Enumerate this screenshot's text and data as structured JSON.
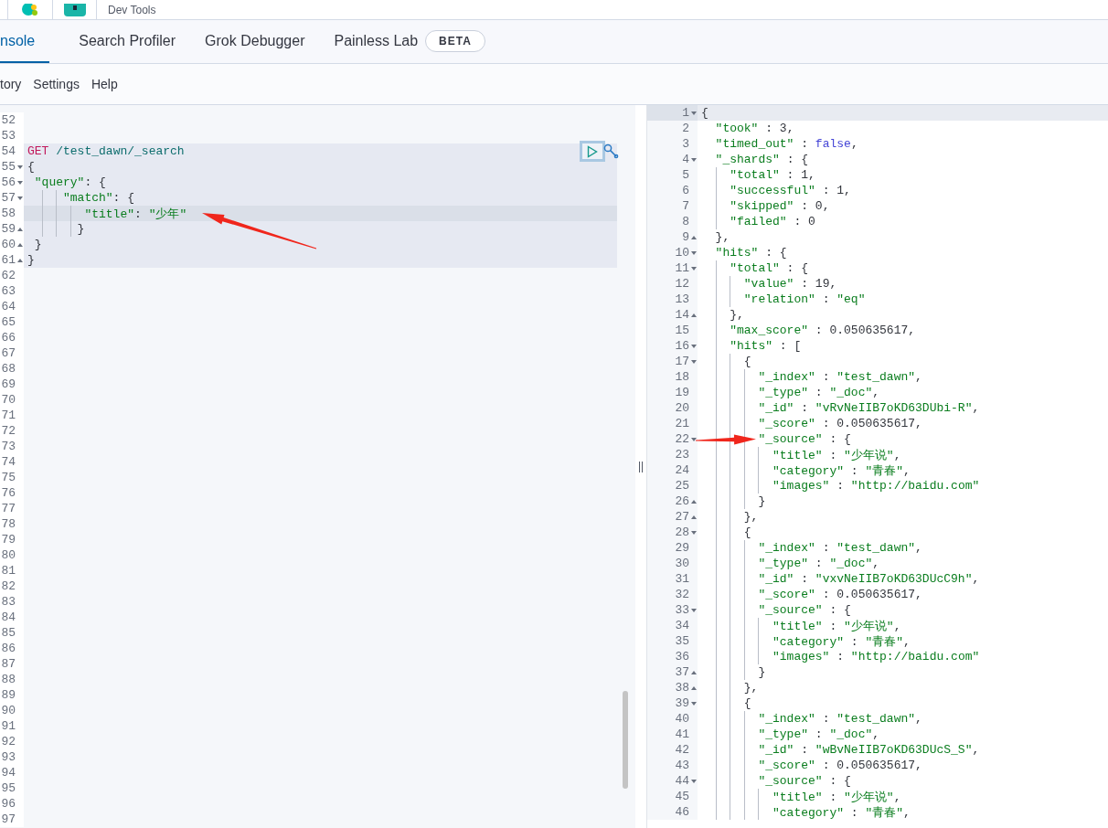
{
  "header": {
    "title": "Dev Tools"
  },
  "tabs": [
    {
      "label": "nsole",
      "selected": true
    },
    {
      "label": "Search Profiler",
      "selected": false
    },
    {
      "label": "Grok Debugger",
      "selected": false
    },
    {
      "label": "Painless Lab",
      "selected": false,
      "badge": "BETA"
    }
  ],
  "menu": [
    "tory",
    "Settings",
    "Help"
  ],
  "request_editor": {
    "lines": [
      {
        "n": "52",
        "in_request": false,
        "active": false
      },
      {
        "n": "53",
        "in_request": false,
        "active": false
      },
      {
        "n": "54",
        "text": "GET /test_dawn/_search",
        "in_request": true,
        "active": false
      },
      {
        "n": "55",
        "text": "{",
        "fold_start": true,
        "in_request": true,
        "active": false
      },
      {
        "n": "56",
        "text": " \"query\": {",
        "fold_start": true,
        "in_request": true,
        "active": false
      },
      {
        "n": "57",
        "text": "     \"match\": {",
        "fold_start": true,
        "in_request": true,
        "active": false
      },
      {
        "n": "58",
        "text": "        \"title\": \"少年\"",
        "in_request": true,
        "active": true
      },
      {
        "n": "59",
        "text": "       }",
        "fold_start": false,
        "in_request": true,
        "active": false
      },
      {
        "n": "60",
        "text": " }",
        "fold_start": false,
        "in_request": true,
        "active": false
      },
      {
        "n": "61",
        "text": "}",
        "fold_start": false,
        "in_request": true,
        "active": false
      },
      {
        "n": "62",
        "in_request": false,
        "active": false
      },
      {
        "n": "63",
        "in_request": false,
        "active": false
      },
      {
        "n": "64",
        "in_request": false,
        "active": false
      },
      {
        "n": "65",
        "in_request": false,
        "active": false
      },
      {
        "n": "66",
        "in_request": false,
        "active": false
      },
      {
        "n": "67",
        "in_request": false,
        "active": false
      },
      {
        "n": "68",
        "in_request": false,
        "active": false
      },
      {
        "n": "69",
        "in_request": false,
        "active": false
      },
      {
        "n": "70",
        "in_request": false,
        "active": false
      },
      {
        "n": "71",
        "in_request": false,
        "active": false
      },
      {
        "n": "72",
        "in_request": false,
        "active": false
      },
      {
        "n": "73",
        "in_request": false,
        "active": false
      },
      {
        "n": "74",
        "in_request": false,
        "active": false
      },
      {
        "n": "75",
        "in_request": false,
        "active": false
      },
      {
        "n": "76",
        "in_request": false,
        "active": false
      },
      {
        "n": "77",
        "in_request": false,
        "active": false
      },
      {
        "n": "78",
        "in_request": false,
        "active": false
      },
      {
        "n": "79",
        "in_request": false,
        "active": false
      },
      {
        "n": "80",
        "in_request": false,
        "active": false
      },
      {
        "n": "81",
        "in_request": false,
        "active": false
      },
      {
        "n": "82",
        "in_request": false,
        "active": false
      },
      {
        "n": "83",
        "in_request": false,
        "active": false
      },
      {
        "n": "84",
        "in_request": false,
        "active": false
      },
      {
        "n": "85",
        "in_request": false,
        "active": false
      },
      {
        "n": "86",
        "in_request": false,
        "active": false
      },
      {
        "n": "87",
        "in_request": false,
        "active": false
      },
      {
        "n": "88",
        "in_request": false,
        "active": false
      },
      {
        "n": "89",
        "in_request": false,
        "active": false
      },
      {
        "n": "90",
        "in_request": false,
        "active": false
      },
      {
        "n": "91",
        "in_request": false,
        "active": false
      },
      {
        "n": "92",
        "in_request": false,
        "active": false
      },
      {
        "n": "93",
        "in_request": false,
        "active": false
      },
      {
        "n": "94",
        "in_request": false,
        "active": false
      },
      {
        "n": "95",
        "in_request": false,
        "active": false
      },
      {
        "n": "96",
        "in_request": false,
        "active": false
      },
      {
        "n": "97",
        "in_request": false,
        "active": false
      }
    ]
  },
  "response_editor": {
    "lines": [
      {
        "n": "1",
        "text": "{",
        "fold_start": true,
        "active": true
      },
      {
        "n": "2",
        "text": "  \"took\" : 3,",
        "active": false
      },
      {
        "n": "3",
        "text": "  \"timed_out\" : false,",
        "active": false
      },
      {
        "n": "4",
        "text": "  \"_shards\" : {",
        "fold_start": true,
        "active": false
      },
      {
        "n": "5",
        "text": "    \"total\" : 1,",
        "active": false
      },
      {
        "n": "6",
        "text": "    \"successful\" : 1,",
        "active": false
      },
      {
        "n": "7",
        "text": "    \"skipped\" : 0,",
        "active": false
      },
      {
        "n": "8",
        "text": "    \"failed\" : 0",
        "active": false
      },
      {
        "n": "9",
        "text": "  },",
        "fold_start": false,
        "active": false
      },
      {
        "n": "10",
        "text": "  \"hits\" : {",
        "fold_start": true,
        "active": false
      },
      {
        "n": "11",
        "text": "    \"total\" : {",
        "fold_start": true,
        "active": false
      },
      {
        "n": "12",
        "text": "      \"value\" : 19,",
        "active": false
      },
      {
        "n": "13",
        "text": "      \"relation\" : \"eq\"",
        "active": false
      },
      {
        "n": "14",
        "text": "    },",
        "fold_start": false,
        "active": false
      },
      {
        "n": "15",
        "text": "    \"max_score\" : 0.050635617,",
        "active": false
      },
      {
        "n": "16",
        "text": "    \"hits\" : [",
        "fold_start": true,
        "active": false
      },
      {
        "n": "17",
        "text": "      {",
        "fold_start": true,
        "active": false
      },
      {
        "n": "18",
        "text": "        \"_index\" : \"test_dawn\",",
        "active": false
      },
      {
        "n": "19",
        "text": "        \"_type\" : \"_doc\",",
        "active": false
      },
      {
        "n": "20",
        "text": "        \"_id\" : \"vRvNeIIB7oKD63DUbi-R\",",
        "active": false
      },
      {
        "n": "21",
        "text": "        \"_score\" : 0.050635617,",
        "active": false
      },
      {
        "n": "22",
        "text": "        \"_source\" : {",
        "fold_start": true,
        "active": false
      },
      {
        "n": "23",
        "text": "          \"title\" : \"少年说\",",
        "active": false
      },
      {
        "n": "24",
        "text": "          \"category\" : \"青春\",",
        "active": false
      },
      {
        "n": "25",
        "text": "          \"images\" : \"http://baidu.com\"",
        "active": false
      },
      {
        "n": "26",
        "text": "        }",
        "fold_start": false,
        "active": false
      },
      {
        "n": "27",
        "text": "      },",
        "fold_start": false,
        "active": false
      },
      {
        "n": "28",
        "text": "      {",
        "fold_start": true,
        "active": false
      },
      {
        "n": "29",
        "text": "        \"_index\" : \"test_dawn\",",
        "active": false
      },
      {
        "n": "30",
        "text": "        \"_type\" : \"_doc\",",
        "active": false
      },
      {
        "n": "31",
        "text": "        \"_id\" : \"vxvNeIIB7oKD63DUcC9h\",",
        "active": false
      },
      {
        "n": "32",
        "text": "        \"_score\" : 0.050635617,",
        "active": false
      },
      {
        "n": "33",
        "text": "        \"_source\" : {",
        "fold_start": true,
        "active": false
      },
      {
        "n": "34",
        "text": "          \"title\" : \"少年说\",",
        "active": false
      },
      {
        "n": "35",
        "text": "          \"category\" : \"青春\",",
        "active": false
      },
      {
        "n": "36",
        "text": "          \"images\" : \"http://baidu.com\"",
        "active": false
      },
      {
        "n": "37",
        "text": "        }",
        "fold_start": false,
        "active": false
      },
      {
        "n": "38",
        "text": "      },",
        "fold_start": false,
        "active": false
      },
      {
        "n": "39",
        "text": "      {",
        "fold_start": true,
        "active": false
      },
      {
        "n": "40",
        "text": "        \"_index\" : \"test_dawn\",",
        "active": false
      },
      {
        "n": "41",
        "text": "        \"_type\" : \"_doc\",",
        "active": false
      },
      {
        "n": "42",
        "text": "        \"_id\" : \"wBvNeIIB7oKD63DUcS_S\",",
        "active": false
      },
      {
        "n": "43",
        "text": "        \"_score\" : 0.050635617,",
        "active": false
      },
      {
        "n": "44",
        "text": "        \"_source\" : {",
        "fold_start": true,
        "active": false
      },
      {
        "n": "45",
        "text": "          \"title\" : \"少年说\",",
        "active": false
      },
      {
        "n": "46",
        "text": "          \"category\" : \"青春\",",
        "active": false
      }
    ]
  }
}
